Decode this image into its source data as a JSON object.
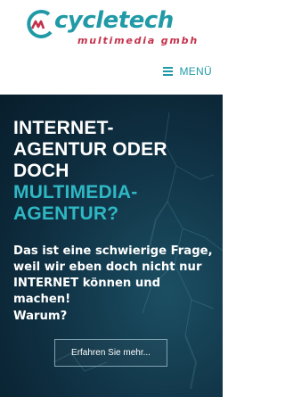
{
  "brand": {
    "name": "cycletech",
    "tagline": "multimedia gmbh",
    "colors": {
      "primary": "#1f9aa6",
      "secondary": "#c4314b",
      "hero_bg": "#0b2636",
      "accent_text": "#2fb8c4"
    }
  },
  "nav": {
    "menu_label": "MENÜ",
    "menu_icon": "hamburger-icon"
  },
  "hero": {
    "headline_lines": [
      "INTERNET-",
      "AGENTUR ODER",
      "DOCH"
    ],
    "headline_accent_lines": [
      "MULTIMEDIA-",
      "AGENTUR?"
    ],
    "subtext": "Das ist eine schwierige Frage, weil wir eben doch nicht nur INTERNET können und machen!",
    "question": "Warum?",
    "cta_label": "Erfahren Sie mehr..."
  }
}
